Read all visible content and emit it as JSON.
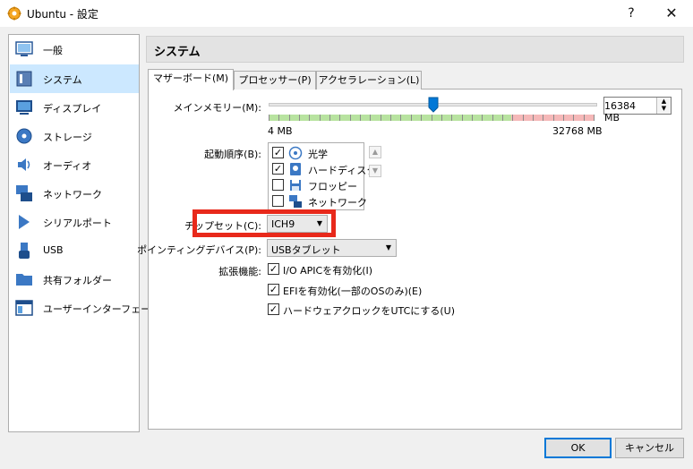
{
  "window": {
    "title": "Ubuntu - 設定",
    "help": "?",
    "close": "✕"
  },
  "sidebar": {
    "items": [
      {
        "label": "一般",
        "icon": "general-icon",
        "selected": false
      },
      {
        "label": "システム",
        "icon": "system-icon",
        "selected": true
      },
      {
        "label": "ディスプレイ",
        "icon": "display-icon",
        "selected": false
      },
      {
        "label": "ストレージ",
        "icon": "storage-icon",
        "selected": false
      },
      {
        "label": "オーディオ",
        "icon": "audio-icon",
        "selected": false
      },
      {
        "label": "ネットワーク",
        "icon": "network-icon",
        "selected": false
      },
      {
        "label": "シリアルポート",
        "icon": "serial-port-icon",
        "selected": false
      },
      {
        "label": "USB",
        "icon": "usb-icon",
        "selected": false
      },
      {
        "label": "共有フォルダー",
        "icon": "shared-folder-icon",
        "selected": false
      },
      {
        "label": "ユーザーインターフェース",
        "icon": "user-interface-icon",
        "selected": false
      }
    ]
  },
  "section": {
    "title": "システム"
  },
  "tabs": [
    {
      "label": "マザーボード(M)",
      "active": true
    },
    {
      "label": "プロセッサー(P)",
      "active": false
    },
    {
      "label": "アクセラレーション(L)",
      "active": false
    }
  ],
  "motherboard": {
    "memory": {
      "label": "メインメモリー(M):",
      "value": "16384 MB",
      "min_label": "4 MB",
      "max_label": "32768 MB",
      "fraction": 0.5
    },
    "boot_order": {
      "label": "起動順序(B):",
      "items": [
        {
          "label": "光学",
          "checked": true,
          "icon": "optical-disc-icon"
        },
        {
          "label": "ハードディスク",
          "checked": true,
          "icon": "hard-disk-icon"
        },
        {
          "label": "フロッピー",
          "checked": false,
          "icon": "floppy-icon"
        },
        {
          "label": "ネットワーク",
          "checked": false,
          "icon": "network-icon"
        }
      ]
    },
    "chipset": {
      "label": "チップセット(C):",
      "value": "ICH9"
    },
    "pointing": {
      "label": "ポインティングデバイス(P):",
      "value": "USBタブレット"
    },
    "extended": {
      "label": "拡張機能:",
      "items": [
        {
          "label": "I/O APICを有効化(I)",
          "checked": true
        },
        {
          "label": "EFIを有効化(一部のOSのみ)(E)",
          "checked": true
        },
        {
          "label": "ハードウェアクロックをUTCにする(U)",
          "checked": true
        }
      ]
    }
  },
  "buttons": {
    "ok": "OK",
    "cancel": "キャンセル"
  },
  "colors": {
    "highlight": "#e8291b",
    "selection": "#cce8ff",
    "accent": "#0078d7"
  }
}
